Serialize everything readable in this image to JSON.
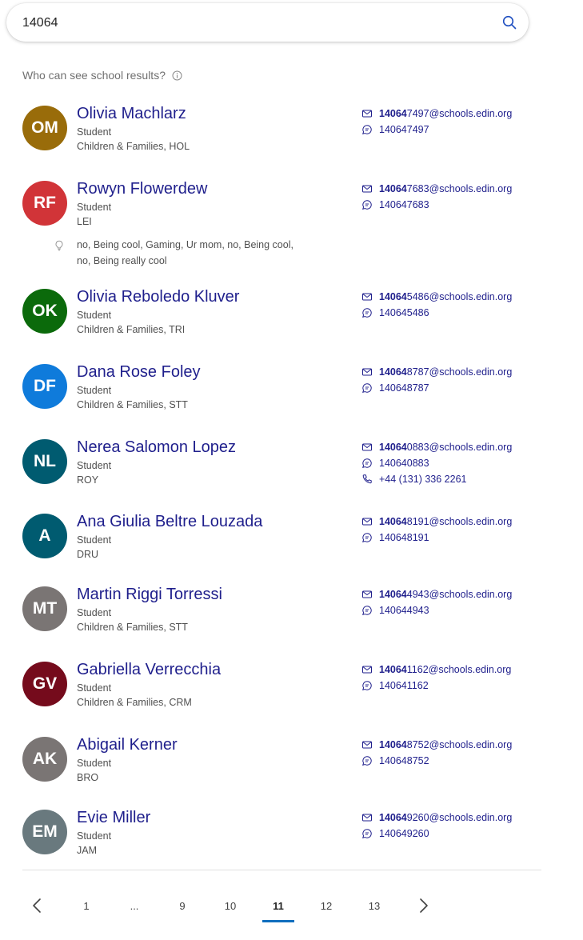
{
  "search": {
    "value": "14064",
    "placeholder": ""
  },
  "scope_text": "Who can see school results?",
  "colors": {
    "link": "#1f1f8c",
    "accent": "#106ebe"
  },
  "people": [
    {
      "initials": "OM",
      "avatar_color": "#996c0a",
      "name": "Olivia Machlarz",
      "title": "Student",
      "dept": "Children & Families, HOL",
      "email_bold": "14064",
      "email_rest": "7497@schools.edin.org",
      "chat": "140647497"
    },
    {
      "initials": "RF",
      "avatar_color": "#d13438",
      "name": "Rowyn Flowerdew",
      "title": "Student",
      "dept": "LEI",
      "interests_line1": "no, Being cool, Gaming, Ur mom, no, Being cool,",
      "interests_line2": "no, Being really cool",
      "email_bold": "14064",
      "email_rest": "7683@schools.edin.org",
      "chat": "140647683"
    },
    {
      "initials": "OK",
      "avatar_color": "#0b6a0b",
      "name": "Olivia Reboledo Kluver",
      "title": "Student",
      "dept": "Children & Families, TRI",
      "email_bold": "14064",
      "email_rest": "5486@schools.edin.org",
      "chat": "140645486"
    },
    {
      "initials": "DF",
      "avatar_color": "#0f7bdb",
      "name": "Dana Rose Foley",
      "title": "Student",
      "dept": "Children & Families, STT",
      "email_bold": "14064",
      "email_rest": "8787@schools.edin.org",
      "chat": "140648787"
    },
    {
      "initials": "NL",
      "avatar_color": "#005b70",
      "name": "Nerea Salomon Lopez",
      "title": "Student",
      "dept": "ROY",
      "email_bold": "14064",
      "email_rest": "0883@schools.edin.org",
      "chat": "140640883",
      "phone": "+44 (131) 336 2261"
    },
    {
      "initials": "A",
      "avatar_color": "#005b70",
      "name": "Ana Giulia Beltre Louzada",
      "title": "Student",
      "dept": "DRU",
      "email_bold": "14064",
      "email_rest": "8191@schools.edin.org",
      "chat": "140648191"
    },
    {
      "initials": "MT",
      "avatar_color": "#7a7574",
      "name": "Martin Riggi Torressi",
      "title": "Student",
      "dept": "Children & Families, STT",
      "email_bold": "14064",
      "email_rest": "4943@schools.edin.org",
      "chat": "140644943"
    },
    {
      "initials": "GV",
      "avatar_color": "#750b1c",
      "name": "Gabriella Verrecchia",
      "title": "Student",
      "dept": "Children & Families, CRM",
      "email_bold": "14064",
      "email_rest": "1162@schools.edin.org",
      "chat": "140641162"
    },
    {
      "initials": "AK",
      "avatar_color": "#7a7574",
      "name": "Abigail Kerner",
      "title": "Student",
      "dept": "BRO",
      "email_bold": "14064",
      "email_rest": "8752@schools.edin.org",
      "chat": "140648752"
    },
    {
      "initials": "EM",
      "avatar_color": "#69797e",
      "name": "Evie Miller",
      "title": "Student",
      "dept": "JAM",
      "email_bold": "14064",
      "email_rest": "9260@schools.edin.org",
      "chat": "140649260"
    }
  ],
  "pagination": {
    "pages": [
      "1",
      "...",
      "9",
      "10",
      "11",
      "12",
      "13"
    ],
    "current": "11"
  }
}
